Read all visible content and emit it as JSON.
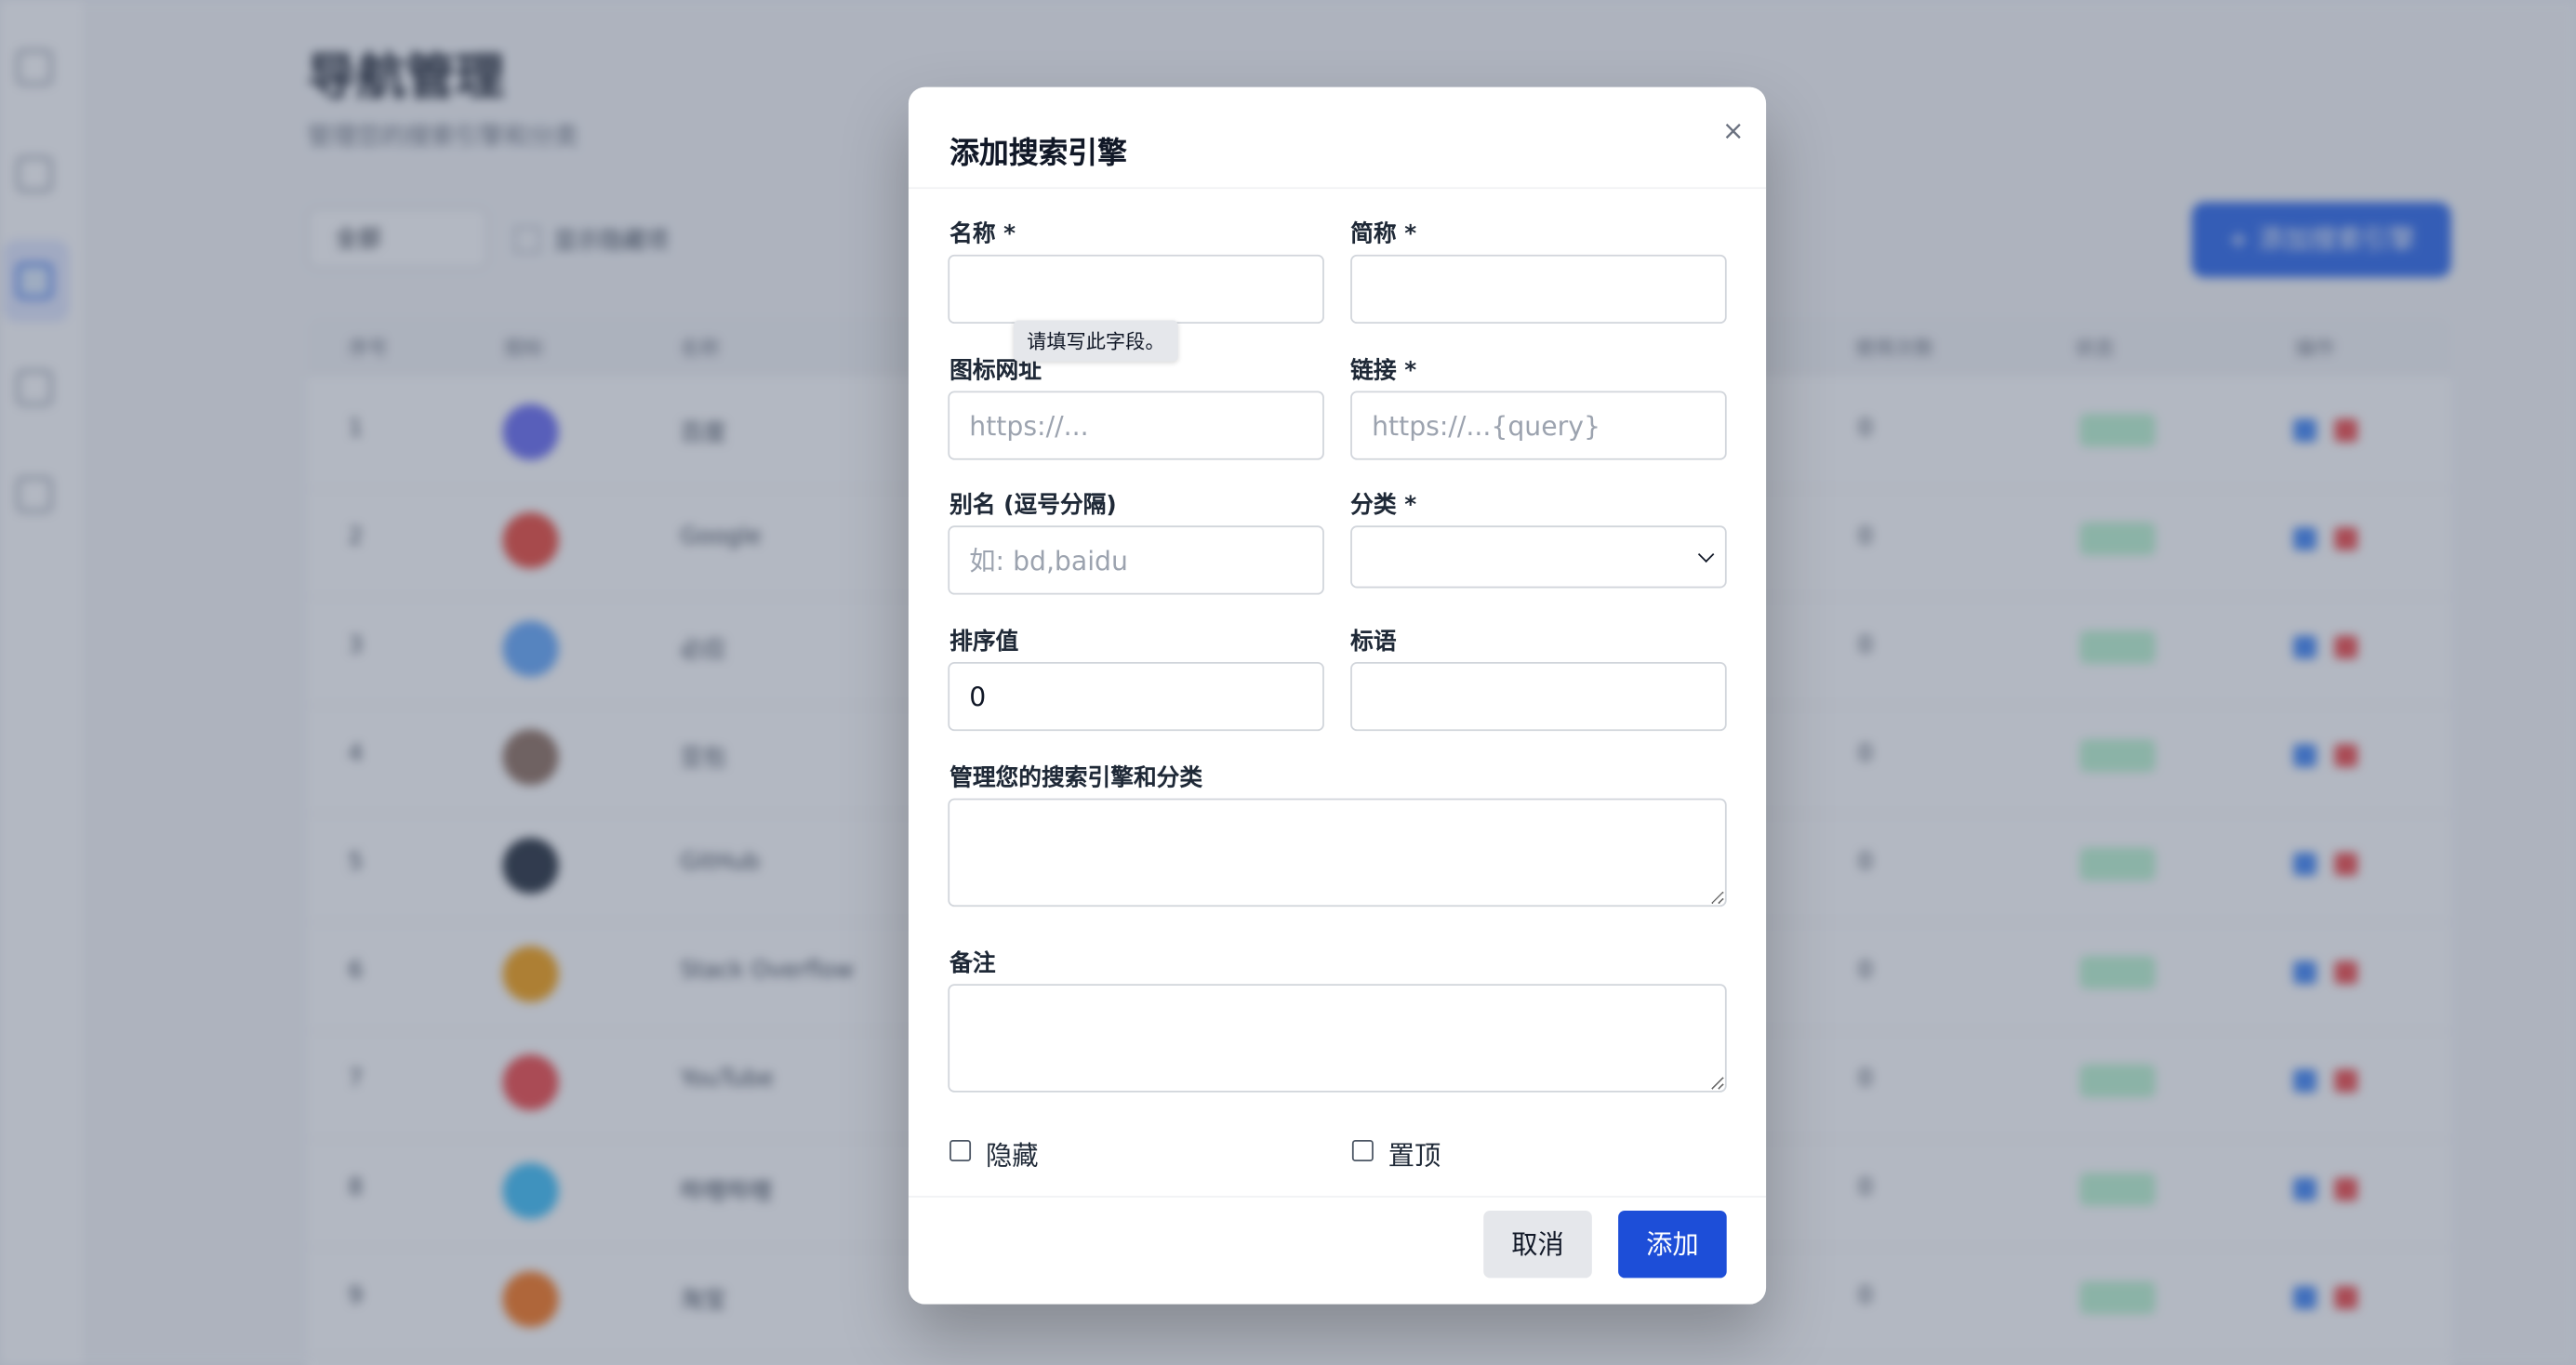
{
  "background": {
    "page_title": "导航管理",
    "page_subtitle": "管理您的搜索引擎和分类",
    "filter_select": "全部",
    "filter_checkbox_label": "显示隐藏项",
    "add_button": "+ 添加搜索引擎",
    "columns": [
      "序号",
      "图标",
      "名称",
      "",
      "",
      "",
      "",
      "",
      "使用次数",
      "状态",
      "操作"
    ],
    "rows": [
      {
        "index": "1",
        "name": "百度",
        "icon_color": "#6366f1"
      },
      {
        "index": "2",
        "name": "Google",
        "icon_color": "#ea4335"
      },
      {
        "index": "3",
        "name": "必应",
        "icon_color": "#60a5fa"
      },
      {
        "index": "4",
        "name": "豆包",
        "icon_color": "#8b6b5a"
      },
      {
        "index": "5",
        "name": "GitHub",
        "icon_color": "#1f2937"
      },
      {
        "index": "6",
        "name": "Stack Overflow",
        "icon_color": "#f59e0b"
      },
      {
        "index": "7",
        "name": "YouTube",
        "icon_color": "#ef4444"
      },
      {
        "index": "8",
        "name": "哔哩哔哩",
        "icon_color": "#38bdf8"
      },
      {
        "index": "9",
        "name": "淘宝",
        "icon_color": "#f97316"
      }
    ]
  },
  "modal": {
    "title": "添加搜索引擎",
    "close_icon": "×",
    "fields": {
      "name_label": "名称 *",
      "short_label": "简称 *",
      "icon_url_label": "图标网址",
      "icon_url_placeholder": "https://...",
      "link_label": "链接 *",
      "link_placeholder": "https://...{query}",
      "alias_label": "别名 (逗号分隔)",
      "alias_placeholder": "如: bd,baidu",
      "category_label": "分类 *",
      "category_value": "",
      "sort_label": "排序值",
      "sort_value": "0",
      "slogan_label": "标语",
      "description_label": "管理您的搜索引擎和分类",
      "notes_label": "备注"
    },
    "tooltip": "请填写此字段。",
    "checkboxes": {
      "hidden_label": "隐藏",
      "pinned_label": "置顶"
    },
    "buttons": {
      "cancel": "取消",
      "add": "添加"
    },
    "colors": {
      "primary": "#1d4ed8",
      "cancel_bg": "#e5e7eb"
    }
  }
}
